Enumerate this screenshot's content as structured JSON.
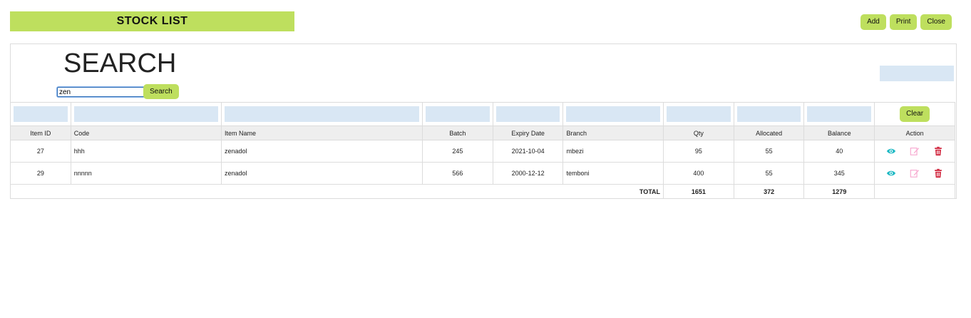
{
  "header": {
    "title": "STOCK LIST"
  },
  "toolbar": {
    "add_label": "Add",
    "print_label": "Print",
    "close_label": "Close"
  },
  "search": {
    "heading": "SEARCH",
    "value": "zen",
    "button_label": "Search"
  },
  "table": {
    "clear_label": "Clear",
    "columns": [
      "Item ID",
      "Code",
      "Item Name",
      "Batch",
      "Expiry Date",
      "Branch",
      "Qty",
      "Allocated",
      "Balance",
      "Action"
    ],
    "rows": [
      {
        "item_id": "27",
        "code": "hhh",
        "item_name": "zenadol",
        "batch": "245",
        "expiry_date": "2021-10-04",
        "branch": "mbezi",
        "qty": "95",
        "allocated": "55",
        "balance": "40"
      },
      {
        "item_id": "29",
        "code": "nnnnn",
        "item_name": "zenadol",
        "batch": "566",
        "expiry_date": "2000-12-12",
        "branch": "temboni",
        "qty": "400",
        "allocated": "55",
        "balance": "345"
      }
    ],
    "total": {
      "label": "TOTAL",
      "qty": "1651",
      "allocated": "372",
      "balance": "1279"
    }
  },
  "icons": {
    "view": "eye-icon",
    "edit": "edit-icon",
    "delete": "trash-icon"
  },
  "colors": {
    "accent": "#bedf5e",
    "filter_box": "#d9e7f4",
    "view_icon": "#1fb9c4",
    "edit_icon": "#f7a8cf",
    "delete_icon": "#d0223a"
  }
}
